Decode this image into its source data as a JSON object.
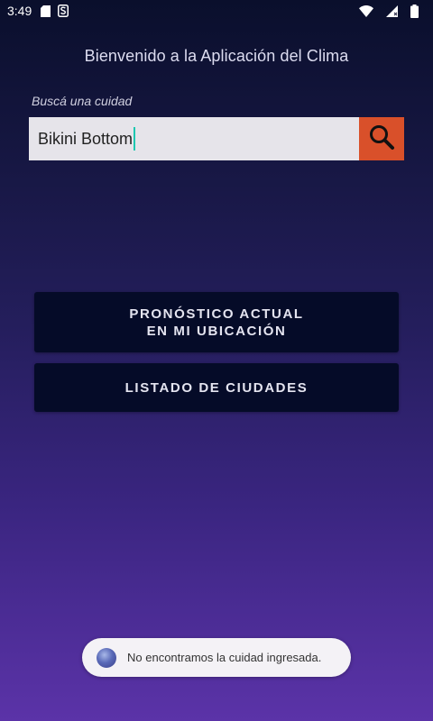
{
  "status_bar": {
    "time": "3:49",
    "left_icons": [
      "sd-card-icon",
      "s-notification-icon"
    ],
    "right_icons": [
      "wifi-icon",
      "signal-icon",
      "battery-icon"
    ]
  },
  "header": {
    "title": "Bienvenido a la Aplicación del Clima"
  },
  "search": {
    "label": "Buscá una cuidad",
    "value": "Bikini Bottom",
    "icon": "search-icon",
    "button_color": "#d9502a"
  },
  "buttons": {
    "current_forecast": "PRONÓSTICO ACTUAL\nEN MI UBICACIÓN",
    "city_list": "LISTADO DE CIUDADES"
  },
  "toast": {
    "message": "No encontramos la cuidad ingresada."
  },
  "colors": {
    "background_top": "#0a0f2c",
    "background_bottom": "#5b33a8",
    "button_background": "#050b28",
    "input_background": "#e6e4ea"
  }
}
